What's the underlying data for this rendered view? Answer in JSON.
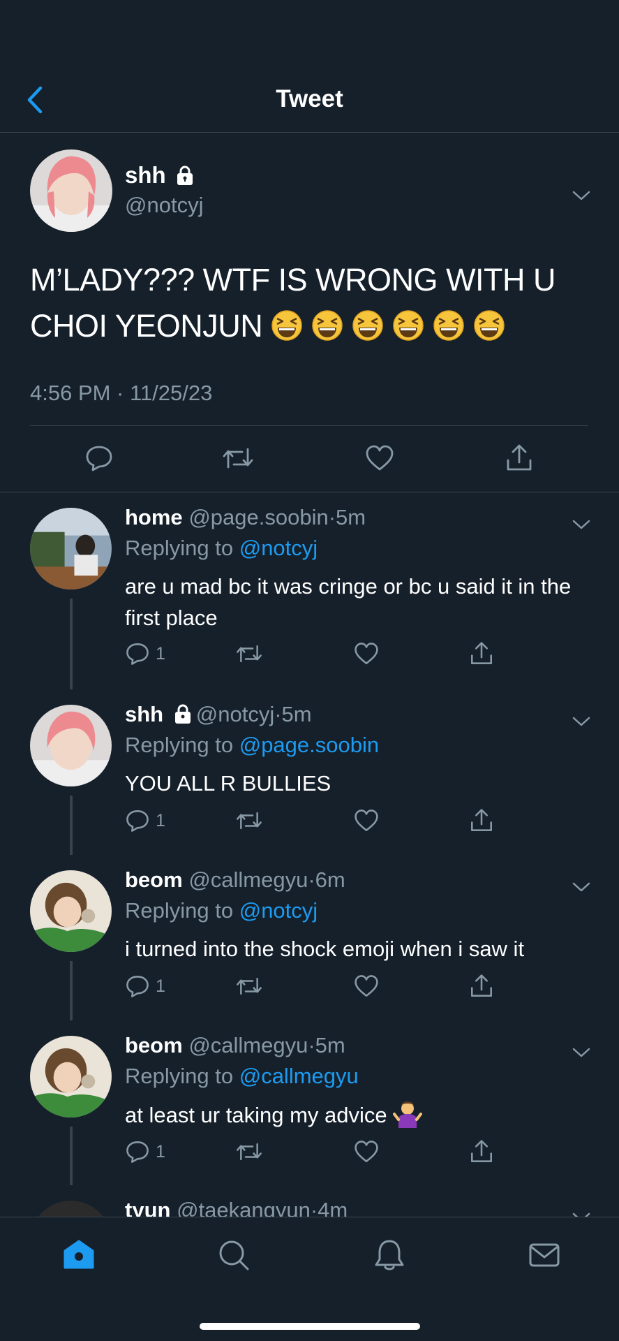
{
  "header": {
    "title": "Tweet"
  },
  "main_tweet": {
    "name": "shh",
    "handle": "@notcyj",
    "text": "M’LADY??? WTF IS WRONG WITH U CHOI YEONJUN",
    "emoji_count": 6,
    "timestamp": "4:56 PM · 11/25/23"
  },
  "replies": [
    {
      "name": "home",
      "handle": "@page.soobin",
      "dot": "·",
      "time": "5m",
      "replying_label": "Replying to ",
      "replying_to": "@notcyj",
      "text": "are u mad bc it was cringe or bc u said it in the first place",
      "reply_count": "1",
      "locked": false
    },
    {
      "name": "shh",
      "handle": "@notcyj",
      "dot": "·",
      "time": "5m",
      "replying_label": "Replying to ",
      "replying_to": "@page.soobin",
      "text": "YOU ALL R BULLIES",
      "reply_count": "1",
      "locked": true
    },
    {
      "name": "beom",
      "handle": "@callmegyu",
      "dot": "·",
      "time": "6m",
      "replying_label": "Replying to ",
      "replying_to": "@notcyj",
      "text": "i turned into the shock emoji when i saw it",
      "reply_count": "1",
      "locked": false
    },
    {
      "name": "beom",
      "handle": "@callmegyu",
      "dot": "·",
      "time": "5m",
      "replying_label": "Replying to ",
      "replying_to": "@callmegyu",
      "text": "at least ur taking my advice",
      "reply_count": "1",
      "locked": false
    },
    {
      "name": "tyun",
      "handle": "@taekangyun",
      "dot": "·",
      "time": "4m"
    }
  ],
  "colors": {
    "background": "#15202b",
    "divider": "#38444d",
    "muted": "#8899a6",
    "accent": "#1d9bf0"
  },
  "icons": {
    "back": "chevron-left-icon",
    "lock": "lock-icon",
    "more": "chevron-down-icon",
    "reply": "reply-icon",
    "retweet": "retweet-icon",
    "like": "heart-icon",
    "share": "share-icon",
    "tabs": [
      "home-icon",
      "search-icon",
      "notifications-icon",
      "messages-icon"
    ]
  }
}
